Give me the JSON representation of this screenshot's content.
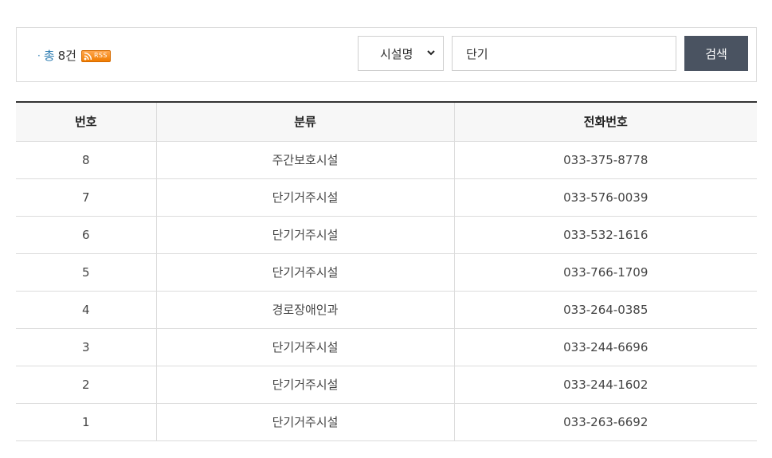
{
  "summary": {
    "bullet": "·",
    "total_label": "총",
    "total_count": "8건",
    "rss_label": "RSS"
  },
  "search": {
    "field_selected": "시설명",
    "field_options": [
      "시설명"
    ],
    "query_value": "단기",
    "button_label": "검색"
  },
  "table": {
    "headers": [
      "번호",
      "분류",
      "전화번호"
    ],
    "rows": [
      {
        "no": "8",
        "category": "주간보호시설",
        "phone": "033-375-8778"
      },
      {
        "no": "7",
        "category": "단기거주시설",
        "phone": "033-576-0039"
      },
      {
        "no": "6",
        "category": "단기거주시설",
        "phone": "033-532-1616"
      },
      {
        "no": "5",
        "category": "단기거주시설",
        "phone": "033-766-1709"
      },
      {
        "no": "4",
        "category": "경로장애인과",
        "phone": "033-264-0385"
      },
      {
        "no": "3",
        "category": "단기거주시설",
        "phone": "033-244-6696"
      },
      {
        "no": "2",
        "category": "단기거주시설",
        "phone": "033-244-1602"
      },
      {
        "no": "1",
        "category": "단기거주시설",
        "phone": "033-263-6692"
      }
    ]
  },
  "icons": {
    "rss": "rss-feed-icon",
    "select_arrow": "chevron-down-icon"
  },
  "colors": {
    "accent": "#2a7ab0",
    "button": "#4a5361",
    "rss": "#f07c00"
  }
}
